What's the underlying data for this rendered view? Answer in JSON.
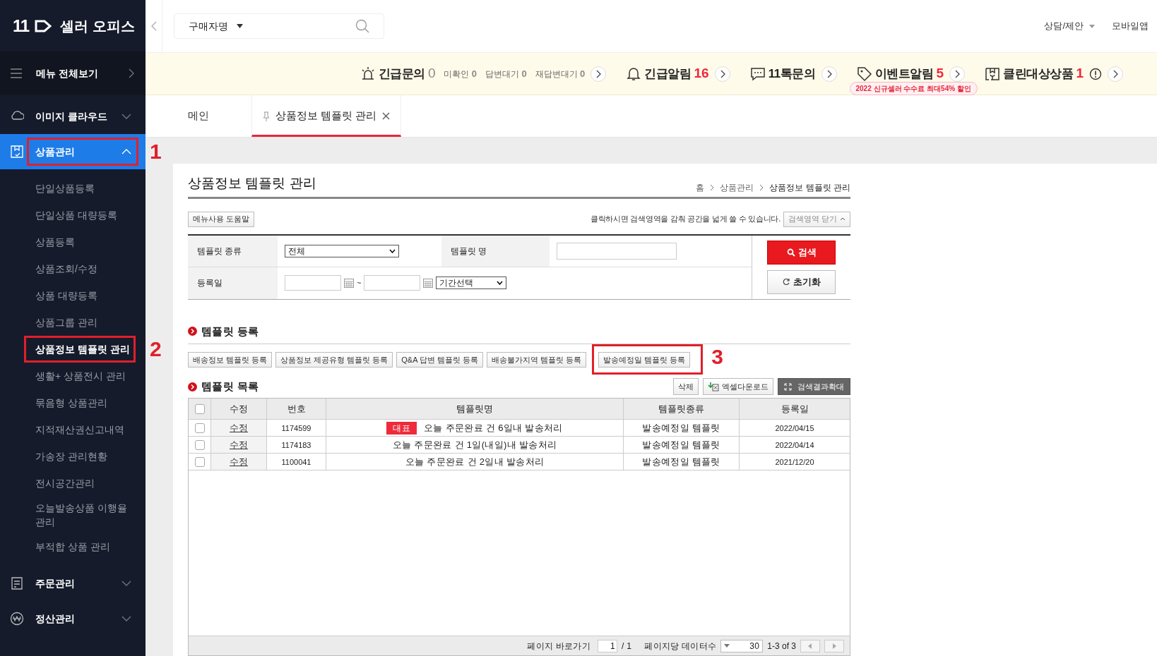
{
  "logo": {
    "mark": "11",
    "title": "셀러 오피스"
  },
  "search": {
    "scope": "구매자명"
  },
  "header_links": [
    {
      "label": "상담/제안",
      "has_menu": true
    },
    {
      "label": "모바일앱",
      "has_menu": false
    }
  ],
  "alerts": [
    {
      "kind": "siren",
      "label": "긴급문의",
      "count": "0",
      "highlight": false,
      "sub": [
        {
          "label": "미확인",
          "count": "0"
        },
        {
          "label": "답변대기",
          "count": "0"
        },
        {
          "label": "재답변대기",
          "count": "0"
        }
      ]
    },
    {
      "kind": "bell",
      "label": "긴급알림",
      "count": "16",
      "highlight": true
    },
    {
      "kind": "chat",
      "label": "11톡문의"
    },
    {
      "kind": "tag",
      "label": "이벤트알림",
      "count": "5",
      "highlight": true,
      "promo": "2022 신규셀러 수수료 최대54% 할인"
    },
    {
      "kind": "box",
      "label": "클린대상상품",
      "count": "1",
      "highlight": true,
      "info": true
    }
  ],
  "sidebar": {
    "menu_all": "메뉴 전체보기",
    "sections": [
      {
        "kind": "cloud",
        "label": "이미지 클라우드",
        "expanded": false,
        "selected": false
      },
      {
        "kind": "product",
        "label": "상품관리",
        "expanded": true,
        "selected": true,
        "annotation": "1",
        "children": [
          {
            "label": "단일상품등록",
            "selected": false
          },
          {
            "label": "단일상품 대량등록",
            "selected": false
          },
          {
            "label": "상품등록",
            "selected": false
          },
          {
            "label": "상품조회/수정",
            "selected": false
          },
          {
            "label": "상품 대량등록",
            "selected": false
          },
          {
            "label": "상품그룹 관리",
            "selected": false
          },
          {
            "label": "상품정보 템플릿 관리",
            "selected": true,
            "annotation": "2"
          },
          {
            "label": "생활+ 상품전시 관리",
            "selected": false
          },
          {
            "label": "묶음형 상품관리",
            "selected": false
          },
          {
            "label": "지적재산권신고내역",
            "selected": false
          },
          {
            "label": "가송장 관리현황",
            "selected": false
          },
          {
            "label": "전시공간관리",
            "selected": false
          },
          {
            "label": "오늘발송상품 이행율관리",
            "selected": false
          },
          {
            "label": "부적합 상품 관리",
            "selected": false
          }
        ]
      },
      {
        "kind": "order",
        "label": "주문관리",
        "expanded": false,
        "selected": false
      },
      {
        "kind": "won",
        "label": "정산관리",
        "expanded": false,
        "selected": false
      }
    ]
  },
  "tabs": [
    {
      "label": "메인",
      "selected": false,
      "pinned": false,
      "closable": false
    },
    {
      "label": "상품정보 템플릿 관리",
      "selected": true,
      "pinned": true,
      "closable": true
    }
  ],
  "page": {
    "title": "상품정보 템플릿 관리",
    "breadcrumb": [
      "홈",
      "상품관리",
      "상품정보 템플릿 관리"
    ],
    "help_button": "메뉴사용 도움말",
    "collapse_hint": "클릭하시면 검색영역을 감춰 공간을 넓게 쓸 수 있습니다.",
    "collapse_button": "검색영역 닫기"
  },
  "search_form": {
    "type_label": "템플릿 종류",
    "type_value": "전체",
    "name_label": "템플릿 명",
    "date_label": "등록일",
    "date_separator": "~",
    "period_value": "기간선택",
    "search_button": "검색",
    "reset_button": "초기화"
  },
  "register": {
    "title": "템플릿 등록",
    "buttons": [
      {
        "label": "배송정보 템플릿 등록"
      },
      {
        "label": "상품정보 제공유형 템플릿 등록"
      },
      {
        "label": "Q&A 답변 템플릿 등록"
      },
      {
        "label": "배송불가지역 템플릿 등록"
      },
      {
        "label": "발송예정일 템플릿 등록",
        "annotation": "3"
      }
    ]
  },
  "list": {
    "title": "템플릿 목록",
    "actions": [
      {
        "kind": "delete",
        "label": "삭제"
      },
      {
        "kind": "excel",
        "label": "엑셀다운로드"
      },
      {
        "kind": "expand",
        "label": "검색결과확대"
      }
    ],
    "header_checked": false,
    "columns": [
      "수정",
      "번호",
      "템플릿명",
      "템플릿종류",
      "등록일"
    ],
    "rows": [
      {
        "checked": false,
        "edit": "수정",
        "number": "1174599",
        "badge": "대표",
        "name": "오늘 주문완료 건 6일내 발송처리",
        "type": "발송예정일 템플릿",
        "date": "2022/04/15"
      },
      {
        "checked": false,
        "edit": "수정",
        "number": "1174183",
        "name": "오늘 주문완료 건 1일(내일)내 발송처리",
        "type": "발송예정일 템플릿",
        "date": "2022/04/14"
      },
      {
        "checked": false,
        "edit": "수정",
        "number": "1100041",
        "name": "오늘 주문완료 건 2일내 발송처리",
        "type": "발송예정일 템플릿",
        "date": "2021/12/20"
      }
    ],
    "footer": {
      "goto_label": "페이지 바로가기",
      "page": "1",
      "total_pages": "/ 1",
      "per_page_label": "페이지당 데이터수",
      "per_page": "30",
      "range": "1-3 of 3"
    }
  }
}
